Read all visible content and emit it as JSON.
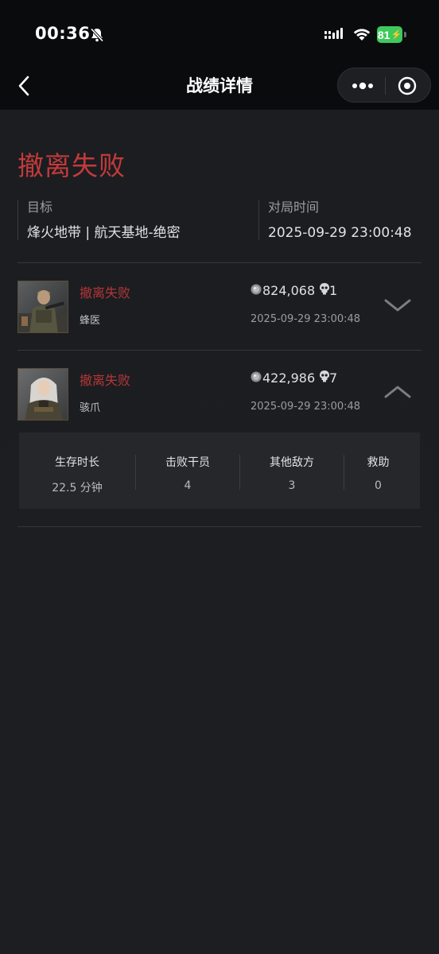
{
  "status_bar": {
    "time": "00:36",
    "battery": "81"
  },
  "nav": {
    "title": "战绩详情"
  },
  "result": {
    "title": "撤离失败"
  },
  "info": {
    "target_label": "目标",
    "target_value": "烽火地带 | 航天基地-绝密",
    "time_label": "对局时间",
    "time_value": "2025-09-29 23:00:48"
  },
  "players": [
    {
      "status": "撤离失败",
      "name": "蜂医",
      "coins": "824,068",
      "kills": "1",
      "time": "2025-09-29 23:00:48",
      "expanded": false
    },
    {
      "status": "撤离失败",
      "name": "骇爪",
      "coins": "422,986",
      "kills": "7",
      "time": "2025-09-29 23:00:48",
      "expanded": true
    }
  ],
  "stats": [
    {
      "label": "生存时长",
      "value": "22.5 分钟"
    },
    {
      "label": "击败干员",
      "value": "4"
    },
    {
      "label": "其他敌方",
      "value": "3"
    },
    {
      "label": "救助",
      "value": "0"
    }
  ],
  "colors": {
    "fail_red": "#c33a3a",
    "background": "#1c1e22",
    "battery_green": "#3ec95d"
  },
  "icons": [
    "back-arrow-icon",
    "more-dots-icon",
    "close-target-icon",
    "bell-mute-icon",
    "signal-icon",
    "wifi-icon",
    "coin-icon",
    "skull-icon",
    "chevron-down-icon",
    "chevron-up-icon"
  ]
}
